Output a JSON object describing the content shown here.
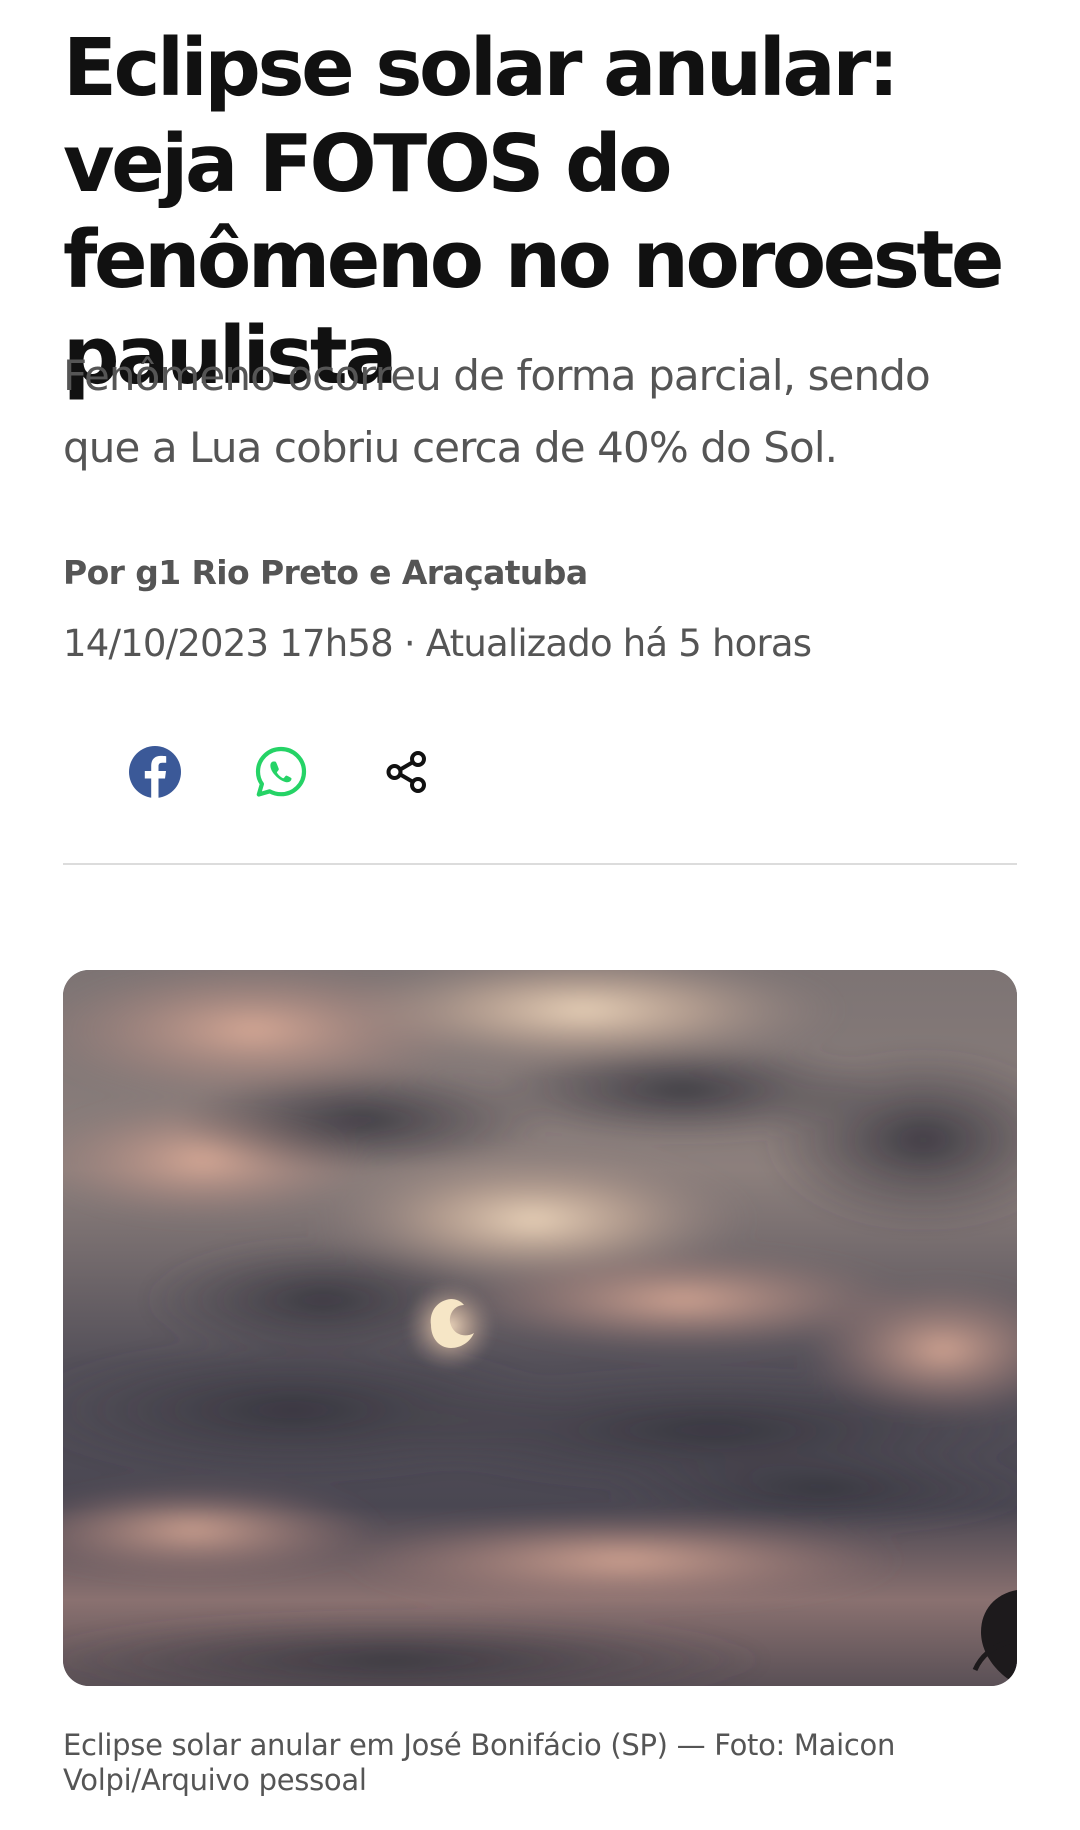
{
  "article": {
    "headline": "Eclipse solar anular: veja FOTOS do fenômeno no noroeste paulista",
    "subtitle": "Fenômeno ocorreu de forma parcial, sendo que a Lua cobriu cerca de 40% do Sol.",
    "byline": "Por g1 Rio Preto e Araçatuba",
    "published": "14/10/2023 17h58",
    "separator": "·",
    "updated": "Atualizado há 5 horas",
    "photo_caption": "Eclipse solar anular em José Bonifácio (SP) — Foto: Maicon Volpi/Arquivo pessoal"
  },
  "share": {
    "buttons": [
      {
        "icon": "facebook-icon",
        "color": "#3b5998"
      },
      {
        "icon": "whatsapp-icon",
        "color": "#25d366"
      },
      {
        "icon": "share-icon",
        "color": "#111111"
      }
    ]
  },
  "colors": {
    "headline": "#111111",
    "secondary_text": "#555555",
    "divider": "#dcdcdc"
  }
}
